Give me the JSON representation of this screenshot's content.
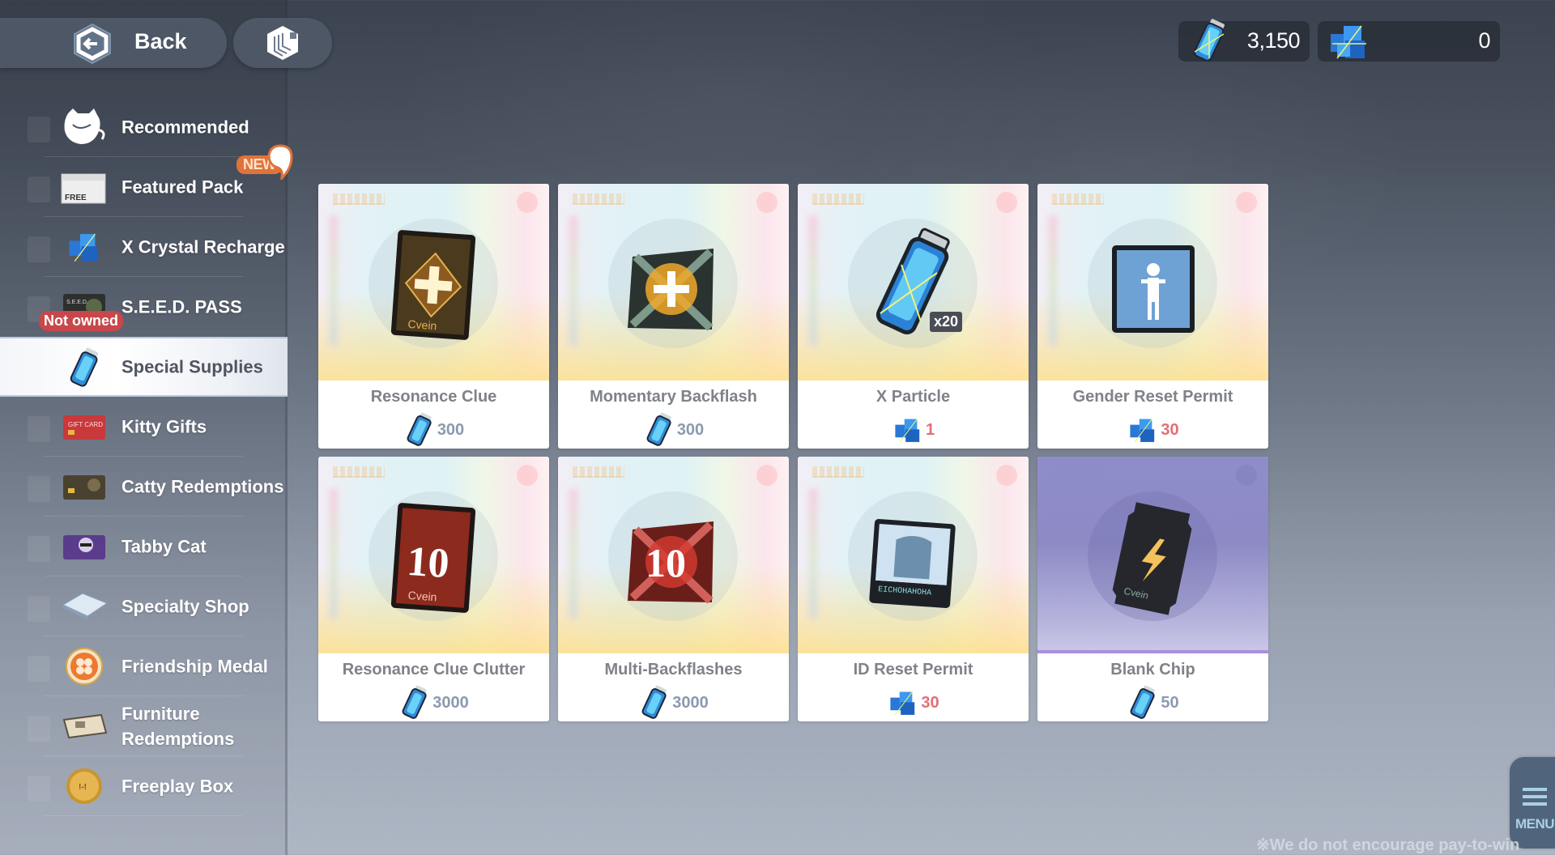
{
  "topbar": {
    "back_label": "Back",
    "back_icon": "hexagon-arrow-back-icon",
    "home_icon": "hexagon-stairs-home-icon"
  },
  "currencies": [
    {
      "name": "x-particle",
      "icon": "x-particle-vial-icon",
      "value": "3,150"
    },
    {
      "name": "x-crystal",
      "icon": "x-crystal-cube-icon",
      "value": "0"
    }
  ],
  "sidebar": {
    "items": [
      {
        "label": "Recommended",
        "icon": "cat-teacup-icon"
      },
      {
        "label": "Featured Pack",
        "icon": "free-box-icon",
        "badge": "NEW"
      },
      {
        "label": "X Crystal Recharge",
        "icon": "x-crystal-cube-icon"
      },
      {
        "label": "S.E.E.D. PASS",
        "icon": "seed-pass-card-icon",
        "badge": "Not owned"
      },
      {
        "label": "Special Supplies",
        "icon": "x-particle-vial-icon",
        "active": true
      },
      {
        "label": "Kitty Gifts",
        "icon": "gift-card-icon"
      },
      {
        "label": "Catty Redemptions",
        "icon": "cat-card-icon"
      },
      {
        "label": "Tabby Cat",
        "icon": "tabby-cat-card-icon"
      },
      {
        "label": "Specialty Shop",
        "icon": "specialty-book-icon"
      },
      {
        "label": "Friendship Medal",
        "icon": "clover-medal-icon"
      },
      {
        "label": "Furniture Redemptions",
        "icon": "furniture-ticket-icon"
      },
      {
        "label": "Freeplay Box",
        "icon": "gold-coin-icon"
      }
    ],
    "badges": {
      "new": "NEW",
      "not_owned": "Not owned"
    }
  },
  "products": [
    {
      "name": "Resonance Clue",
      "icon": "resonance-clue-card-icon",
      "currency": "x-particle",
      "price": "300",
      "price_color": "#8a9aae"
    },
    {
      "name": "Momentary Backflash",
      "icon": "backflash-plus-icon",
      "currency": "x-particle",
      "price": "300",
      "price_color": "#8a9aae"
    },
    {
      "name": "X Particle",
      "icon": "x-particle-vial-icon",
      "quantity": "x20",
      "currency": "x-crystal",
      "price": "1",
      "price_color": "#e26f76"
    },
    {
      "name": "Gender Reset Permit",
      "icon": "gender-permit-icon",
      "currency": "x-crystal",
      "price": "30",
      "price_color": "#e26f76"
    },
    {
      "name": "Resonance Clue Clutter",
      "icon": "resonance-clue-10-card-icon",
      "currency": "x-particle",
      "price": "3000",
      "price_color": "#8a9aae"
    },
    {
      "name": "Multi-Backflashes",
      "icon": "backflash-10-icon",
      "currency": "x-particle",
      "price": "3000",
      "price_color": "#8a9aae"
    },
    {
      "name": "ID Reset Permit",
      "icon": "id-permit-card-icon",
      "currency": "x-crystal",
      "price": "30",
      "price_color": "#e26f76"
    },
    {
      "name": "Blank Chip",
      "icon": "lightning-chip-icon",
      "currency": "x-particle",
      "price": "50",
      "price_color": "#8a9aae",
      "rarity": "purple"
    }
  ],
  "menu": {
    "label": "MENU"
  },
  "footer": {
    "disclaimer": "※We do not encourage pay-to-win"
  }
}
